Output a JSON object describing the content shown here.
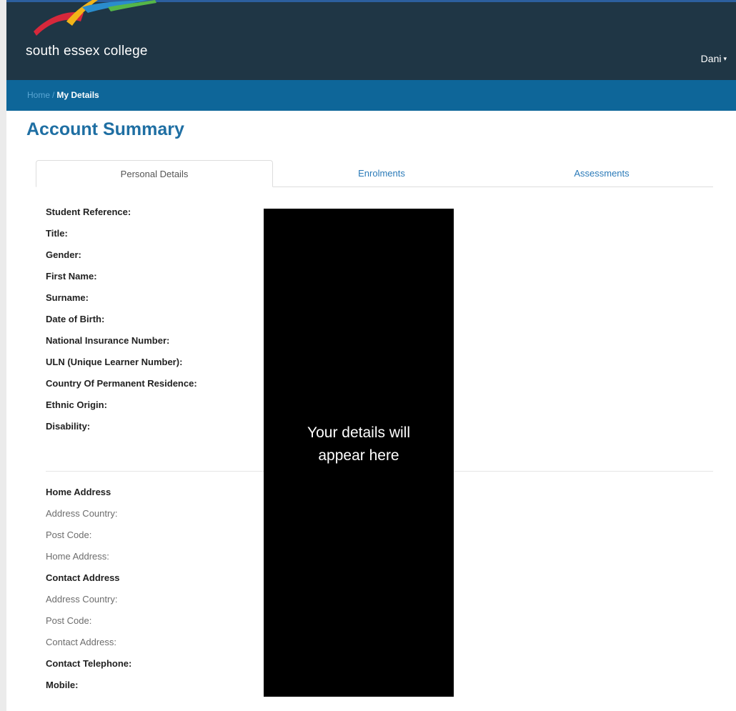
{
  "header": {
    "logo_text": "south essex college",
    "user_name": "Dani",
    "user_caret": "▾"
  },
  "breadcrumb": {
    "home": "Home",
    "separator": "/",
    "current": "My Details"
  },
  "page": {
    "title": "Account Summary"
  },
  "tabs": [
    {
      "label": "Personal Details",
      "active": true
    },
    {
      "label": "Enrolments",
      "active": false
    },
    {
      "label": "Assessments",
      "active": false
    }
  ],
  "personal_fields": [
    "Student Reference:",
    "Title:",
    "Gender:",
    "First Name:",
    "Surname:",
    "Date of Birth:",
    "National Insurance Number:",
    "ULN (Unique Learner Number):",
    "Country Of Permanent Residence:",
    "Ethnic Origin:",
    "Disability:"
  ],
  "address_section": {
    "home_heading": "Home Address",
    "home_fields": [
      "Address Country:",
      "Post Code:",
      "Home Address:"
    ],
    "contact_heading": "Contact Address",
    "contact_fields": [
      "Address Country:",
      "Post Code:",
      "Contact Address:"
    ],
    "telephone": "Contact Telephone:",
    "mobile": "Mobile:"
  },
  "overlay": {
    "line1": "Your details will",
    "line2": "appear here"
  },
  "colors": {
    "header_bg": "#1f3645",
    "breadcrumb_bg": "#0e6699",
    "title": "#1f6fa3",
    "tab_link": "#2a7ab8"
  }
}
